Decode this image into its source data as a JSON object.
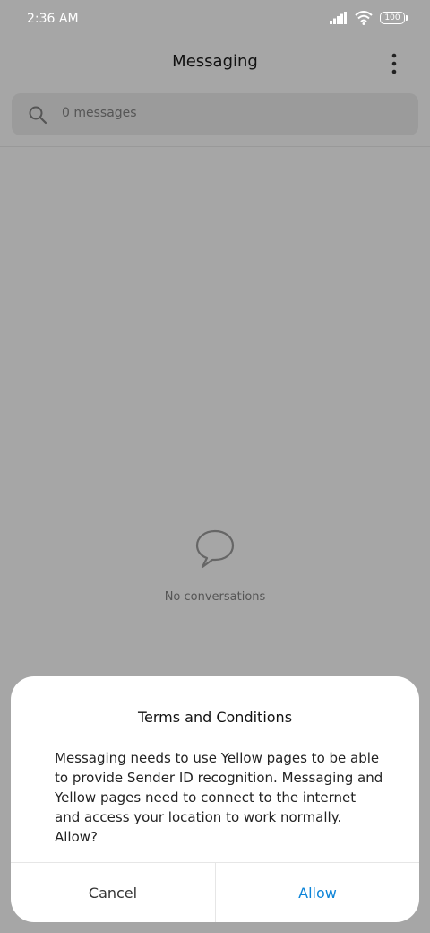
{
  "status_bar": {
    "time": "2:36 AM",
    "battery_level": "100",
    "icons": [
      "signal-icon",
      "wifi-icon",
      "battery-icon"
    ]
  },
  "header": {
    "title": "Messaging",
    "more_icon": "more-vertical-icon"
  },
  "search": {
    "placeholder": "0 messages",
    "icon": "search-icon"
  },
  "empty_state": {
    "icon": "chat-bubble-icon",
    "text": "No conversations"
  },
  "dialog": {
    "title": "Terms and Conditions",
    "body": "Messaging needs to use Yellow pages to be able to provide Sender ID recognition. Messaging and Yellow pages need to connect to the internet and access your location to work normally. Allow?",
    "cancel_label": "Cancel",
    "allow_label": "Allow"
  },
  "colors": {
    "scrim_background": "#a6a6a6",
    "accent": "#0c84d8",
    "dialog_background": "#ffffff"
  }
}
